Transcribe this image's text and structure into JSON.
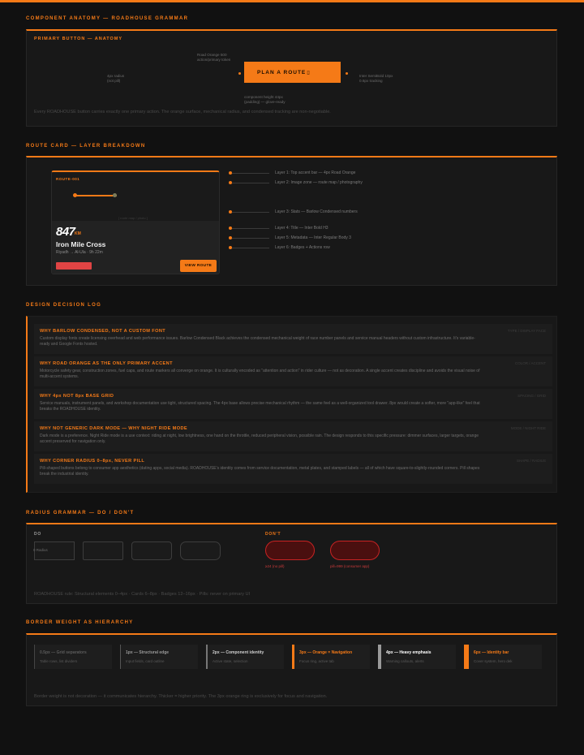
{
  "anatomy": {
    "section_title": "COMPONENT ANATOMY — ROADHOUSE GRAMMAR",
    "panel_label": "PRIMARY BUTTON — ANATOMY",
    "button_label": "PLAN A ROUTE",
    "cursor": "▯",
    "note_surface": "Road Orange 500\naction/primary token",
    "note_radius": "4px radius\n(not pill)",
    "note_type": "Inter SemiBold 10px\n0.6px tracking",
    "note_touch": "component height 44px\n(padding) — glove-ready",
    "caption": "Every ROADHOUSE button carries exactly one primary action. The orange surface, mechanical radius, and condensed tracking are non-negotiable."
  },
  "route_card": {
    "section_title": "ROUTE CARD — LAYER BREAKDOWN",
    "route_id": "ROUTE-001",
    "map_label": "[ route map / photo ]",
    "distance": "847",
    "distance_unit": "KM",
    "name": "Iron Mile Cross",
    "meta": "Riyadh → Al-Ula · 9h 22m",
    "action_label": "VIEW ROUTE",
    "layers": [
      "Layer 1: Top accent bar — 4px Road Orange",
      "Layer 2: Image zone — route map / photography",
      "Layer 3: Stats — Barlow Condensed numbers",
      "Layer 4: Title — Inter Bold H3",
      "Layer 5: Metadata — Inter Regular Body 3",
      "Layer 6: Badges + Actions row"
    ]
  },
  "decision_log": {
    "section_title": "DESIGN DECISION LOG",
    "entries": [
      {
        "title": "WHY BARLOW CONDENSED, NOT A CUSTOM FONT",
        "body": "Custom display fonts create licensing overhead and web performance issues. Barlow Condensed Black achieves the condensed mechanical weight of race number panels and service manual headers without custom infrastructure. It's variable-ready and Google Fonts hosted.",
        "date": "TYPE / DISPLAY FACE"
      },
      {
        "title": "WHY ROAD ORANGE AS THE ONLY PRIMARY ACCENT",
        "body": "Motorcycle safety gear, construction zones, fuel caps, and route markers all converge on orange. It is culturally encoded as \"attention and action\" in rider culture — not as decoration. A single accent creates discipline and avoids the visual noise of multi-accent systems.",
        "date": "COLOR / ACCENT"
      },
      {
        "title": "WHY 4px NOT 8px BASE GRID",
        "body": "Service manuals, instrument panels, and workshop documentation use tight, structured spacing. The 4px base allows precise mechanical rhythm — the same feel as a well-organized tool drawer. 8px would create a softer, more \"app-like\" feel that breaks the ROADHOUSE identity.",
        "date": "SPACING / GRID"
      },
      {
        "title": "WHY NOT GENERIC DARK MODE — WHY NIGHT RIDE MODE",
        "body": "Dark mode is a preference. Night Ride mode is a use context: riding at night, low brightness, one hand on the throttle, reduced peripheral vision, possible rain. The design responds to this specific pressure: dimmer surfaces, larger targets, orange accent preserved for navigation only.",
        "date": "MODE / NIGHT RIDE"
      },
      {
        "title": "WHY CORNER RADIUS 0–8px, NEVER PILL",
        "body": "Pill-shaped buttons belong to consumer app aesthetics (dating apps, social media). ROADHOUSE's identity comes from service documentation, metal plates, and stamped labels — all of which have square-to-slightly-rounded corners. Pill shapes break the industrial identity.",
        "date": "SHAPE / RADIUS"
      }
    ]
  },
  "radius": {
    "section_title": "RADIUS GRAMMAR — DO / DON'T",
    "do_label": "DO",
    "dont_label": "DON'T",
    "do_box_label": "0 Radius",
    "dont_captions": [
      "≥24 (no pill)",
      "pill=999 (consumer app)"
    ],
    "caption": "ROADHOUSE rule: Structural elements 0–4px · Cards 6–8px · Badges 12–16px · Pills: never on primary UI"
  },
  "border_weight": {
    "section_title": "BORDER WEIGHT AS HIERARCHY",
    "cards": [
      {
        "title": "0.5px — Grid separators",
        "sub": "Table rows, list dividers",
        "accent": false
      },
      {
        "title": "1px — Structural edge",
        "sub": "Input fields, card outline",
        "accent": false
      },
      {
        "title": "2px — Component identity",
        "sub": "Active state, selection",
        "accent": false
      },
      {
        "title": "3px — Orange = Navigation",
        "sub": "Focus ring, active tab",
        "accent": true
      },
      {
        "title": "4px — Heavy emphasis",
        "sub": "Warning callouts, alerts",
        "accent": false
      },
      {
        "title": "6px — Identity bar",
        "sub": "Cover system, hero dek",
        "accent": true
      }
    ],
    "caption": "Border weight is not decoration — it communicates hierarchy. Thicker = higher priority. The 3px orange ring is exclusively for focus and navigation."
  },
  "colors": {
    "accent": "#f57a17",
    "background": "#111111",
    "panel": "#181818",
    "danger_fill": "#4a0f0f",
    "danger_border": "#c82323"
  }
}
